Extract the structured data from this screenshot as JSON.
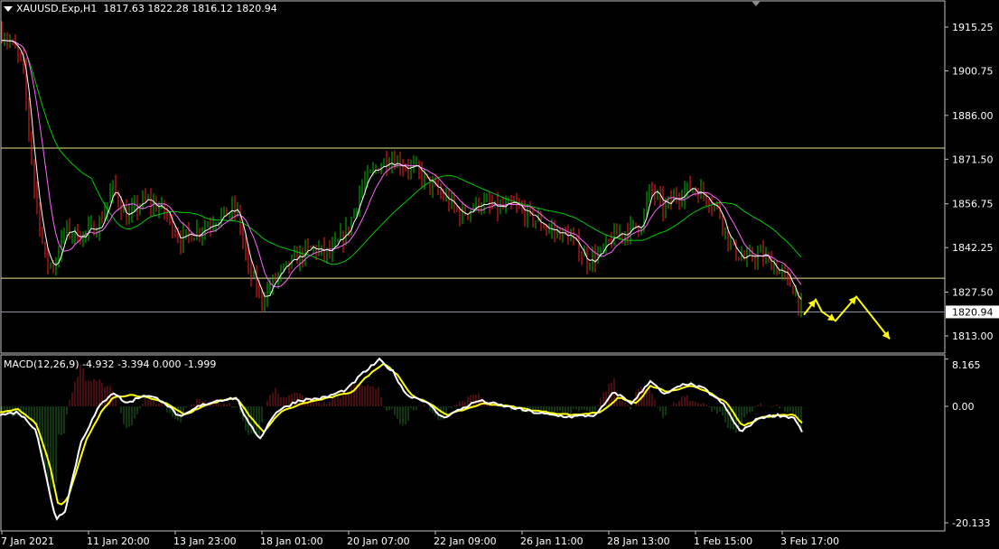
{
  "header": {
    "symbol_label": "XAUUSD.Exp,H1",
    "ohlc": "1817.63 1822.28 1816.12 1820.94"
  },
  "macd_header": "MACD(12,26,9) -4.932 -3.394 0.000 -1.999",
  "colors": {
    "background": "#000000",
    "bull": "#00c000",
    "bear": "#ff2020",
    "ma_fast": "#ffffff",
    "ma_mid": "#ff66ff",
    "ma_slow": "#00cc00",
    "hline": "#e6e68c",
    "current_price_line": "#9090b0",
    "forecast_arrow": "#ffff00",
    "macd_line": "#ffffff",
    "signal_line": "#ffff00",
    "hist_pos": "#8b1a1a",
    "hist_neg": "#1f6b1f"
  },
  "chart_data": {
    "type": "candlestick",
    "title": "XAUUSD.Exp,H1",
    "price_axis": {
      "ticks": [
        "1915.25",
        "1900.75",
        "1886.00",
        "1871.50",
        "1856.75",
        "1842.25",
        "1827.50",
        "1813.00"
      ],
      "ylim": [
        1808.0,
        1920.0
      ],
      "current_price": "1820.94"
    },
    "time_axis": {
      "ticks": [
        "7 Jan 2021",
        "11 Jan 20:00",
        "13 Jan 23:00",
        "18 Jan 01:00",
        "20 Jan 07:00",
        "22 Jan 09:00",
        "26 Jan 11:00",
        "28 Jan 13:00",
        "1 Feb 15:00",
        "3 Feb 17:00"
      ]
    },
    "horizontal_levels": [
      1875.2,
      1832.1
    ],
    "close_path": [
      [
        0,
        1914
      ],
      [
        12,
        1910
      ],
      [
        25,
        1903
      ],
      [
        38,
        1862
      ],
      [
        50,
        1838
      ],
      [
        60,
        1836
      ],
      [
        72,
        1848
      ],
      [
        90,
        1846
      ],
      [
        110,
        1850
      ],
      [
        125,
        1862
      ],
      [
        140,
        1852
      ],
      [
        160,
        1858
      ],
      [
        180,
        1855
      ],
      [
        200,
        1845
      ],
      [
        220,
        1848
      ],
      [
        240,
        1852
      ],
      [
        262,
        1855
      ],
      [
        275,
        1835
      ],
      [
        290,
        1825
      ],
      [
        305,
        1832
      ],
      [
        325,
        1838
      ],
      [
        345,
        1842
      ],
      [
        365,
        1840
      ],
      [
        385,
        1848
      ],
      [
        400,
        1862
      ],
      [
        415,
        1868
      ],
      [
        430,
        1872
      ],
      [
        445,
        1870
      ],
      [
        460,
        1868
      ],
      [
        480,
        1862
      ],
      [
        495,
        1858
      ],
      [
        510,
        1853
      ],
      [
        530,
        1857
      ],
      [
        550,
        1855
      ],
      [
        570,
        1856
      ],
      [
        590,
        1852
      ],
      [
        610,
        1848
      ],
      [
        630,
        1846
      ],
      [
        650,
        1838
      ],
      [
        665,
        1840
      ],
      [
        680,
        1846
      ],
      [
        695,
        1848
      ],
      [
        710,
        1850
      ],
      [
        720,
        1862
      ],
      [
        735,
        1855
      ],
      [
        750,
        1860
      ],
      [
        765,
        1862
      ],
      [
        780,
        1860
      ],
      [
        795,
        1855
      ],
      [
        810,
        1842
      ],
      [
        825,
        1838
      ],
      [
        840,
        1840
      ],
      [
        855,
        1837
      ],
      [
        870,
        1832
      ],
      [
        880,
        1828
      ],
      [
        888,
        1821
      ]
    ],
    "forecast_arrow_points": [
      [
        890,
        1820
      ],
      [
        903,
        1825
      ],
      [
        910,
        1821
      ],
      [
        925,
        1818
      ],
      [
        948,
        1826
      ],
      [
        985,
        1812
      ]
    ],
    "macd": {
      "name": "MACD(12,26,9)",
      "ticks": [
        "8.165",
        "0.00",
        "-20.133"
      ],
      "ylim": [
        -21.5,
        9.5
      ],
      "main_path": [
        [
          0,
          -1.5
        ],
        [
          20,
          -1
        ],
        [
          40,
          -4
        ],
        [
          55,
          -15
        ],
        [
          62,
          -19.5
        ],
        [
          72,
          -18
        ],
        [
          90,
          -6
        ],
        [
          110,
          0
        ],
        [
          125,
          2.5
        ],
        [
          140,
          0.5
        ],
        [
          160,
          2
        ],
        [
          180,
          1
        ],
        [
          200,
          -2
        ],
        [
          220,
          0
        ],
        [
          240,
          1
        ],
        [
          262,
          1.5
        ],
        [
          275,
          -3
        ],
        [
          288,
          -5.5
        ],
        [
          305,
          -1
        ],
        [
          330,
          1
        ],
        [
          360,
          1.5
        ],
        [
          385,
          3
        ],
        [
          400,
          5.5
        ],
        [
          420,
          8
        ],
        [
          435,
          6
        ],
        [
          450,
          2
        ],
        [
          470,
          1
        ],
        [
          490,
          -2
        ],
        [
          510,
          -0.5
        ],
        [
          530,
          1
        ],
        [
          560,
          0
        ],
        [
          590,
          -1
        ],
        [
          610,
          -1.5
        ],
        [
          630,
          -1.8
        ],
        [
          660,
          -1.5
        ],
        [
          680,
          2.5
        ],
        [
          700,
          0.5
        ],
        [
          720,
          4.5
        ],
        [
          735,
          2
        ],
        [
          760,
          4
        ],
        [
          780,
          3
        ],
        [
          800,
          0.5
        ],
        [
          820,
          -4.5
        ],
        [
          840,
          -2
        ],
        [
          860,
          -1.5
        ],
        [
          880,
          -2
        ],
        [
          888,
          -4.5
        ]
      ],
      "signal_path": [
        [
          0,
          -1
        ],
        [
          20,
          -0.5
        ],
        [
          40,
          -3
        ],
        [
          55,
          -10
        ],
        [
          65,
          -17.5
        ],
        [
          75,
          -16
        ],
        [
          95,
          -6
        ],
        [
          112,
          -1
        ],
        [
          125,
          1.5
        ],
        [
          145,
          2
        ],
        [
          165,
          1.5
        ],
        [
          185,
          0.5
        ],
        [
          205,
          -1.5
        ],
        [
          225,
          0
        ],
        [
          245,
          1
        ],
        [
          262,
          1.5
        ],
        [
          278,
          -2
        ],
        [
          292,
          -4.5
        ],
        [
          310,
          -1
        ],
        [
          335,
          0.5
        ],
        [
          365,
          1.5
        ],
        [
          390,
          2.5
        ],
        [
          405,
          5
        ],
        [
          425,
          7.5
        ],
        [
          440,
          5.5
        ],
        [
          455,
          2
        ],
        [
          475,
          0.5
        ],
        [
          495,
          -1.5
        ],
        [
          515,
          -0.5
        ],
        [
          535,
          0.5
        ],
        [
          565,
          0
        ],
        [
          595,
          -0.8
        ],
        [
          615,
          -1.2
        ],
        [
          635,
          -1.5
        ],
        [
          665,
          -1
        ],
        [
          685,
          1.5
        ],
        [
          705,
          0.5
        ],
        [
          720,
          3.5
        ],
        [
          740,
          2.5
        ],
        [
          765,
          3.5
        ],
        [
          785,
          2.5
        ],
        [
          805,
          0.5
        ],
        [
          822,
          -3.5
        ],
        [
          842,
          -2
        ],
        [
          862,
          -1.5
        ],
        [
          880,
          -1.5
        ],
        [
          888,
          -2.8
        ]
      ]
    }
  }
}
